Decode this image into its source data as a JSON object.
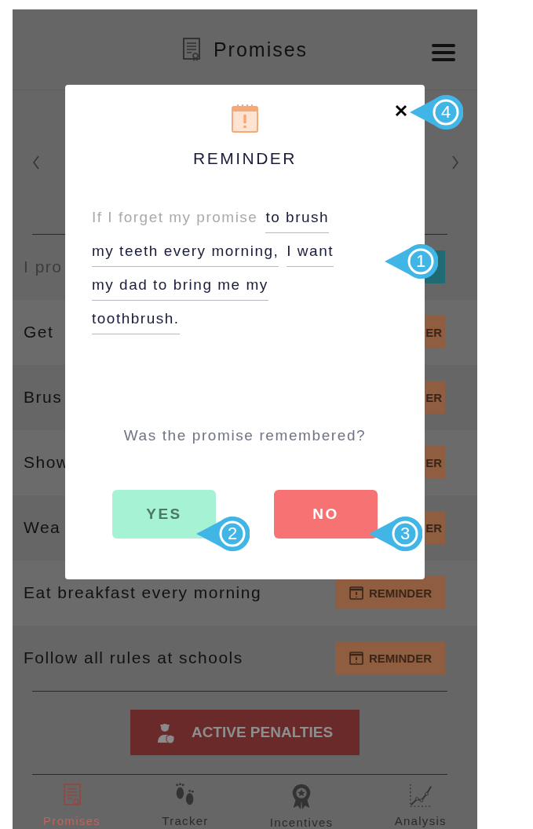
{
  "header": {
    "title": "Promises"
  },
  "promises": [
    {
      "text": "I pro",
      "kind": "done",
      "button": {
        "kind": "done",
        "icon": false
      }
    },
    {
      "text": "Get",
      "kind": "open",
      "button": {
        "kind": "reminder",
        "label": "ER",
        "icon": false
      }
    },
    {
      "text": "Brus",
      "kind": "open",
      "button": {
        "kind": "reminder",
        "label": "ER",
        "icon": false
      }
    },
    {
      "text": "Show",
      "kind": "open",
      "button": {
        "kind": "reminder",
        "label": "ER",
        "icon": false
      }
    },
    {
      "text": "Wea",
      "kind": "open",
      "button": {
        "kind": "reminder",
        "label": "ER",
        "icon": false
      }
    },
    {
      "text": "Eat breakfast every morning",
      "kind": "open",
      "button": {
        "kind": "reminder",
        "label": "REMINDER",
        "icon": true
      }
    },
    {
      "text": "Follow all rules at schools",
      "kind": "open",
      "button": {
        "kind": "reminder",
        "label": "REMINDER",
        "icon": true
      }
    }
  ],
  "penalties_button": {
    "label": "ACTIVE PENALTIES"
  },
  "bottom_nav": [
    {
      "label": "Promises",
      "kind": "promises",
      "selected": true
    },
    {
      "label": "Tracker",
      "kind": "tracker",
      "selected": false
    },
    {
      "label": "Incentives",
      "kind": "incentives",
      "selected": false
    },
    {
      "label": "Analysis",
      "kind": "analysis",
      "selected": false
    }
  ],
  "modal": {
    "title": "REMINDER",
    "sentence_lines": [
      [
        {
          "kind": "prompt",
          "text": "If I forget my promise"
        },
        {
          "kind": "fill",
          "text": "to brush"
        }
      ],
      [
        {
          "kind": "fill",
          "text": "my teeth every morning,"
        },
        {
          "kind": "fill",
          "text": "I want"
        }
      ],
      [
        {
          "kind": "fill",
          "text": "my dad to bring me my"
        }
      ],
      [
        {
          "kind": "fill",
          "text": "toothbrush."
        }
      ]
    ],
    "question": "Was the promise remembered?",
    "yes": "YES",
    "no": "NO"
  },
  "callouts": [
    {
      "number": "1"
    },
    {
      "number": "2"
    },
    {
      "number": "3"
    },
    {
      "number": "4"
    }
  ]
}
